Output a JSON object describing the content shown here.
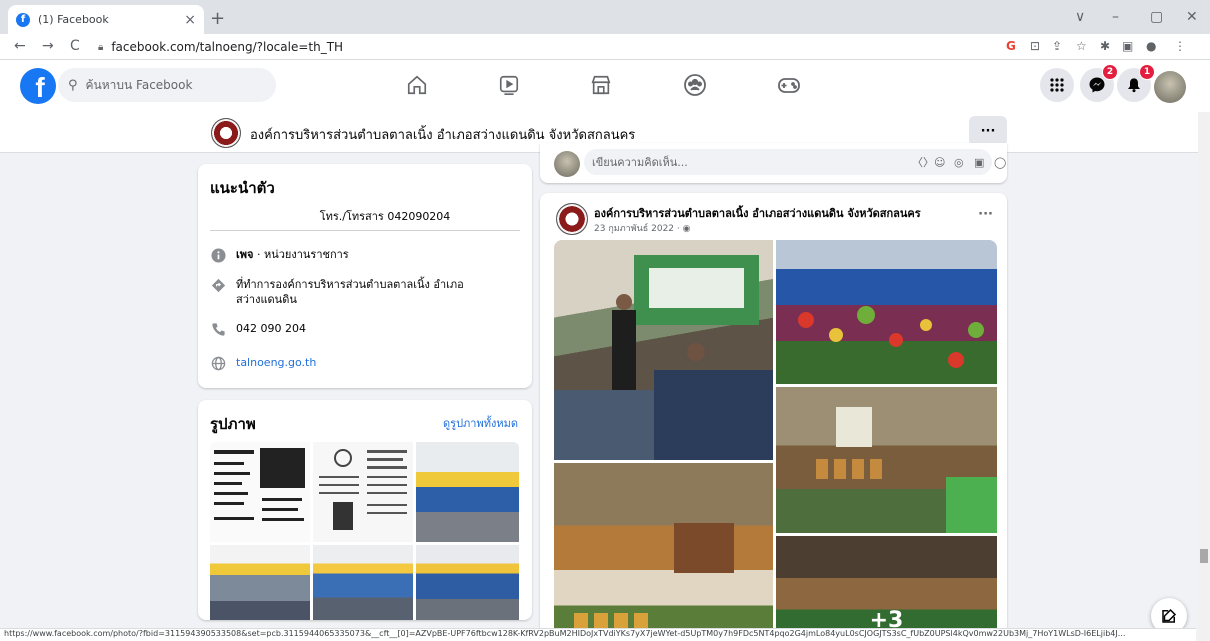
{
  "browser": {
    "tab_title": "(1) Facebook",
    "tab_close": "×",
    "new_tab": "+",
    "url": "facebook.com/talnoeng/?locale=th_TH",
    "window_controls": [
      "∨",
      "–",
      "▢",
      "✕"
    ],
    "nav": {
      "back": "←",
      "forward": "→",
      "reload": "C"
    },
    "extensions": [
      "G",
      "⊡",
      "⇪",
      "☆",
      "✱",
      "▣",
      "●",
      "⋮"
    ]
  },
  "fb": {
    "logo": "f",
    "search_placeholder": "ค้นหาบน Facebook",
    "nav_icons": [
      "home-icon",
      "watch-icon",
      "marketplace-icon",
      "groups-icon",
      "gaming-icon"
    ],
    "right": {
      "menu_icon": "⋮⋮",
      "messenger_badge": "2",
      "notifications_badge": "1"
    }
  },
  "page": {
    "name": "องค์การบริหารส่วนตำบลตาลเนิ้ง อำเภอสว่างแดนดิน จังหวัดสกลนคร",
    "more_label": "···"
  },
  "intro": {
    "title": "แนะนำตัว",
    "tel": "โทร./โทรสาร 042090204",
    "rows": [
      {
        "icon": "info-icon",
        "bold": "เพจ",
        "text": " · หน่วยงานราชการ"
      },
      {
        "icon": "location-icon",
        "text": "ที่ทำการองค์การบริหารส่วนตำบลตาลเนิ้ง อำเภอสว่างแดนดิน"
      },
      {
        "icon": "phone-icon",
        "text": "042 090 204"
      },
      {
        "icon": "globe-icon",
        "text": "talnoeng.go.th"
      }
    ]
  },
  "photos": {
    "title": "รูปภาพ",
    "see_all": "ดูรูปภาพทั้งหมด"
  },
  "comment": {
    "placeholder": "เขียนความคิดเห็น..."
  },
  "post": {
    "author": "องค์การบริหารส่วนตำบลตาลเนิ้ง อำเภอสว่างแดนดิน จังหวัดสกลนคร",
    "date": "23 กุมภาพันธ์ 2022 · ◉",
    "more": "···",
    "extra_photos": "+3"
  },
  "status_url": "https://www.facebook.com/photo/?fbid=311594390533508&set=pcb.3115944065335073&__cft__[0]=AZVpBE-UPF76ftbcw128K-KfRV2pBuM2HIDoJxTVdiYKs7yX7jeWYet-d5UpTM0y7h9FDc5NT4pqo2G4jmLo84yuL0sCJOGJTS3sC_fUbZ0UPSl4kQv0mw22Ub3Mj_7HoY1WLsD-I6ELjib4J...",
  "colors": {
    "fb_blue": "#1877f2",
    "link": "#216fdb",
    "badge": "#e41e3f"
  }
}
